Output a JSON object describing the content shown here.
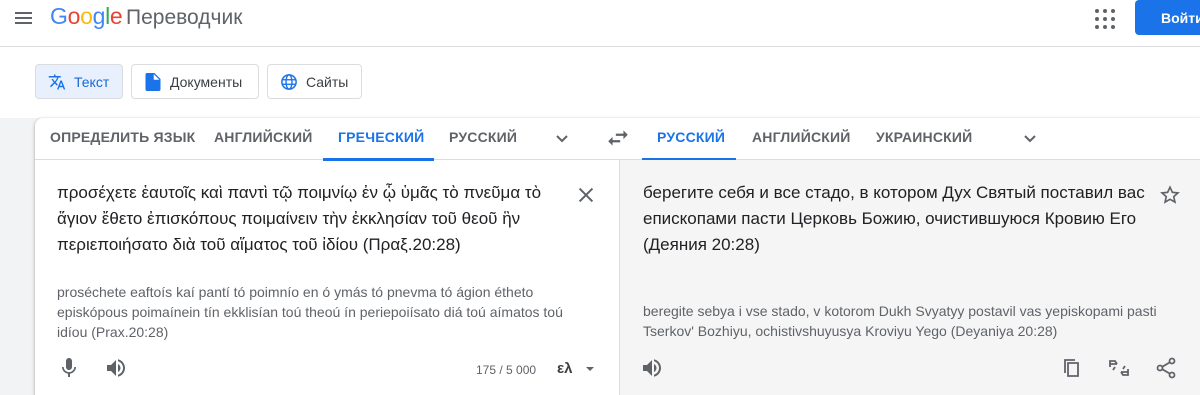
{
  "header": {
    "logo": [
      "G",
      "o",
      "o",
      "g",
      "l",
      "e"
    ],
    "product": "Переводчик",
    "signin_label": "Войти"
  },
  "modes": [
    {
      "label": "Текст",
      "icon": "translate-icon",
      "active": true
    },
    {
      "label": "Документы",
      "icon": "document-icon",
      "active": false
    },
    {
      "label": "Сайты",
      "icon": "globe-icon",
      "active": false
    }
  ],
  "source_langs": [
    "ОПРЕДЕЛИТЬ ЯЗЫК",
    "АНГЛИЙСКИЙ",
    "ГРЕЧЕСКИЙ",
    "РУССКИЙ"
  ],
  "source_selected": "ГРЕЧЕСКИЙ",
  "target_langs": [
    "РУССКИЙ",
    "АНГЛИЙСКИЙ",
    "УКРАИНСКИЙ"
  ],
  "target_selected": "РУССКИЙ",
  "source": {
    "text": "προσέχετε ἑαυτοῖς καὶ παντὶ τῷ ποιμνίῳ ἐν ᾧ ὑμᾶς τὸ πνεῦμα τὸ ἅγιον ἔθετο ἐπισκόπους ποιμαίνειν τὴν ἐκκλησίαν τοῦ θεοῦ ἣν περιεποιήσατο διὰ τοῦ αἵματος τοῦ ἰδίου (Πραξ.20:28)",
    "transliteration": "proséchete eaftoís kaí pantí tó poimnío en ó ymás tó pnevma tó ágion étheto episkópous poimaínein tín ekklisían toú theoú ín periepoiísato diá toú aímatos toú idíou (Prax.20:28)",
    "char_count": "175 / 5 000",
    "keyboard_lang": "ελ"
  },
  "target": {
    "text": "берегите себя и все стадо, в котором Дух Святый поставил вас епископами пасти Церковь Божию, очистившуюся Кровию Его (Деяния 20:28)",
    "transliteration": "beregite sebya i vse stado, v kotorom Dukh Svyatyy postavil vas yepiskopami pasti Tserkov' Bozhiyu, ochistivshuyusya Kroviyu Yego (Deyaniya 20:28)"
  },
  "colors": {
    "accent": "#1a73e8",
    "selected_mode_bg": "#e8f0fe",
    "text_secondary": "#5f6368"
  }
}
